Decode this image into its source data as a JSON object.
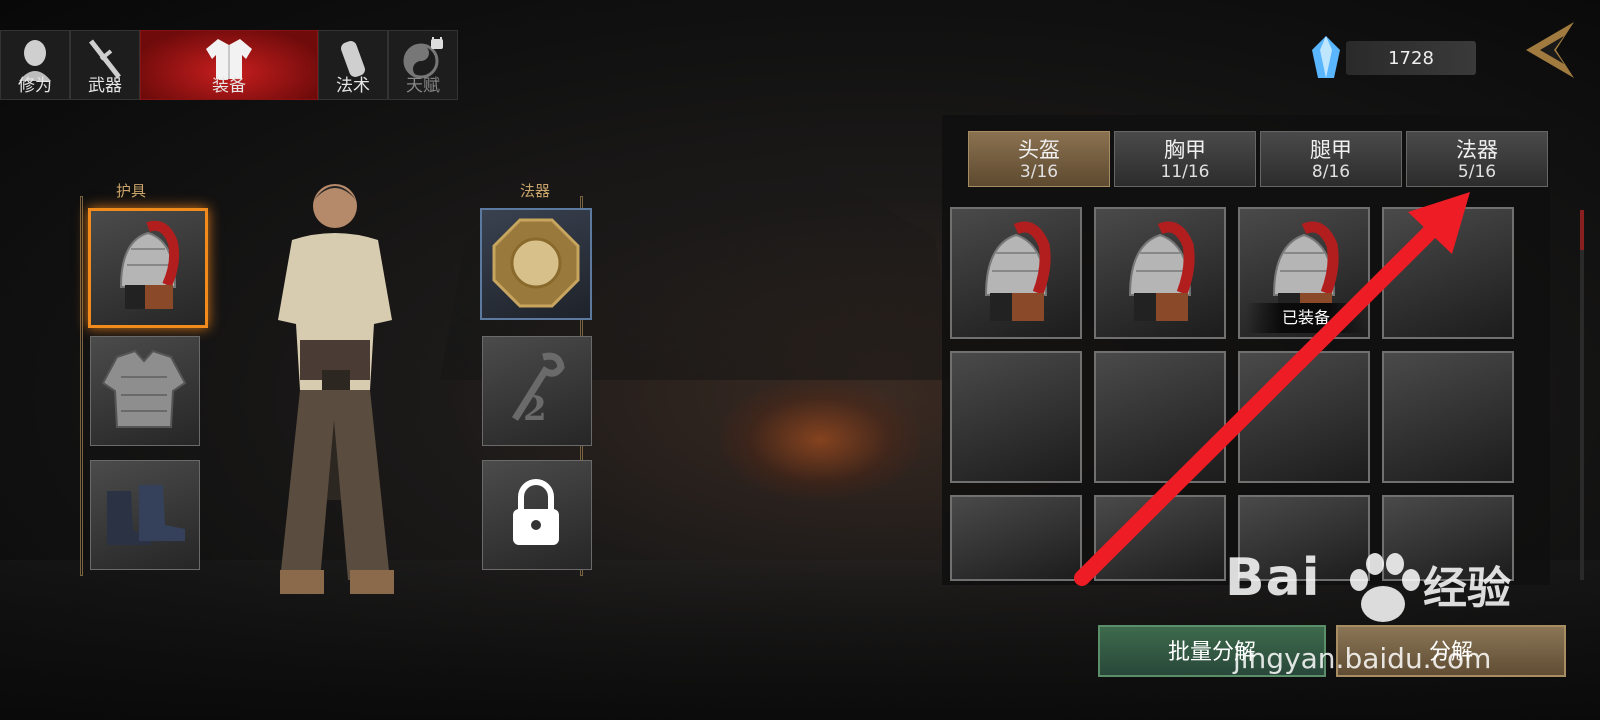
{
  "top_tabs": [
    {
      "label": "修为",
      "icon": "monk-head-icon",
      "state": "normal"
    },
    {
      "label": "武器",
      "icon": "sword-icon",
      "state": "normal"
    },
    {
      "label": "装备",
      "icon": "robe-icon",
      "state": "active"
    },
    {
      "label": "法术",
      "icon": "gourd-icon",
      "state": "normal"
    },
    {
      "label": "天赋",
      "icon": "yin-yang-icon",
      "state": "locked"
    }
  ],
  "currency": {
    "icon": "blue-crystal-icon",
    "amount": "1728"
  },
  "left_panel": {
    "armor_title": "护具",
    "artifact_title": "法器",
    "armor_slots": [
      {
        "item": "helmet-icon",
        "selected": true
      },
      {
        "item": "chest-armor-icon",
        "selected": false
      },
      {
        "item": "boots-icon",
        "selected": false
      }
    ],
    "artifact_slots": [
      {
        "item": "bagua-mirror-icon",
        "state": "equipped"
      },
      {
        "item": "ruyi-scepter-icon",
        "badge": "2",
        "state": "empty"
      },
      {
        "item": "lock-icon",
        "state": "locked"
      }
    ]
  },
  "inventory": {
    "tabs": [
      {
        "name": "头盔",
        "count": "3/16",
        "active": true
      },
      {
        "name": "胸甲",
        "count": "11/16",
        "active": false
      },
      {
        "name": "腿甲",
        "count": "8/16",
        "active": false
      },
      {
        "name": "法器",
        "count": "5/16",
        "active": false
      }
    ],
    "equipped_label": "已装备",
    "rows": 3,
    "cols": 4,
    "items_in_first_row": 3
  },
  "buttons": {
    "batch_decompose": "批量分解",
    "decompose": "分解"
  },
  "watermark": {
    "logo": "Bai",
    "logo_cn": "经验",
    "url": "jingyan.baidu.com"
  },
  "colors": {
    "active_tab_red": "#c81e1e",
    "selected_orange": "#f08b1c",
    "arrow_red": "#ee1c24",
    "green_button": "#3e6a4c",
    "gold_button": "#8a7556"
  }
}
